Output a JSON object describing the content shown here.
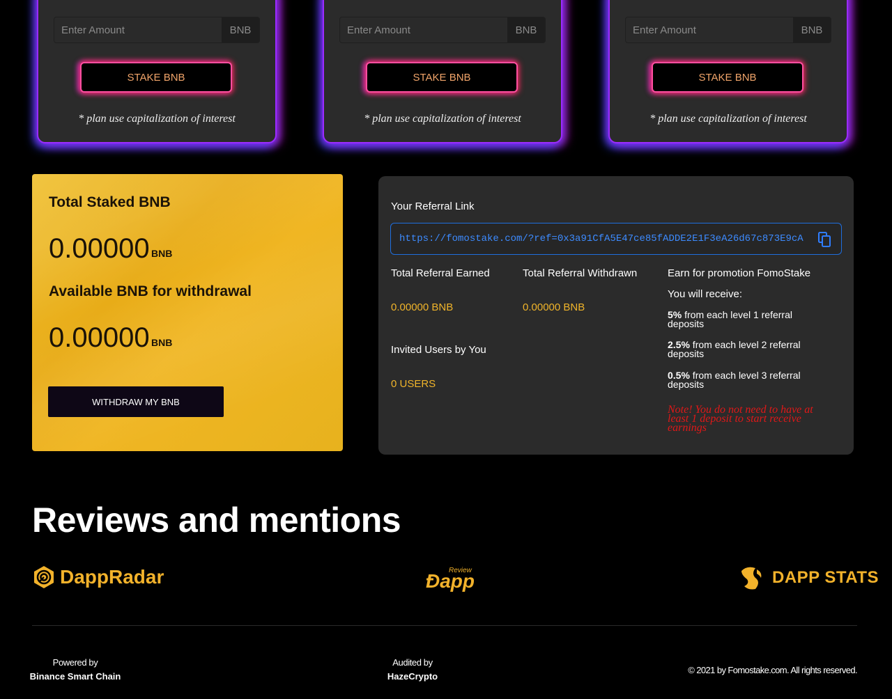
{
  "plans": [
    {
      "input_placeholder": "Enter Amount",
      "unit": "BNB",
      "button": "STAKE BNB",
      "note": "* plan use capitalization of interest"
    },
    {
      "input_placeholder": "Enter Amount",
      "unit": "BNB",
      "button": "STAKE BNB",
      "note": "* plan use capitalization of interest"
    },
    {
      "input_placeholder": "Enter Amount",
      "unit": "BNB",
      "button": "STAKE BNB",
      "note": "* plan use capitalization of interest"
    }
  ],
  "staked": {
    "total_label": "Total Staked BNB",
    "total_value": "0.00000",
    "unit": "BNB",
    "available_label": "Available BNB for withdrawal",
    "available_value": "0.00000",
    "withdraw_button": "WITHDRAW MY BNB"
  },
  "referral": {
    "link_label": "Your Referral Link",
    "link": "https://fomostake.com/?ref=0x3a91CfA5E47ce85fADDE2E1F3eA26d67c873E9cA",
    "earned_label": "Total Referral Earned",
    "earned_value": "0.00000 BNB",
    "withdrawn_label": "Total Referral Withdrawn",
    "withdrawn_value": "0.00000 BNB",
    "invited_label": "Invited Users by You",
    "invited_value": "0 USERS",
    "promo_title": "Earn for promotion FomoStake",
    "receive_label": "You will receive:",
    "levels": [
      {
        "percent": "5%",
        "text": " from each level 1 referral deposits"
      },
      {
        "percent": "2.5%",
        "text": " from each level 2 referral deposits"
      },
      {
        "percent": "0.5%",
        "text": " from each level 3 referral deposits"
      }
    ],
    "note": "Note! You do not need to have at least 1 deposit to start receive earnings"
  },
  "reviews": {
    "title": "Reviews and mentions",
    "logos": {
      "dappradar": "DappRadar",
      "dapp_review_small": "Review",
      "dapp_review": "Dapp",
      "dapp_stats": "DAPP STATS"
    }
  },
  "footer": {
    "powered_label": "Powered by",
    "powered_value": "Binance Smart Chain",
    "audited_label": "Audited by",
    "audited_value": "HazeCrypto",
    "copyright": "© 2021 by Fomostake.com. All rights reserved."
  },
  "colors": {
    "accent_gold": "#f0b42a",
    "panel_dark": "#2b2b2b",
    "link_blue": "#3d8bff",
    "note_red": "#e01818",
    "glow_purple": "#9b2cff"
  }
}
